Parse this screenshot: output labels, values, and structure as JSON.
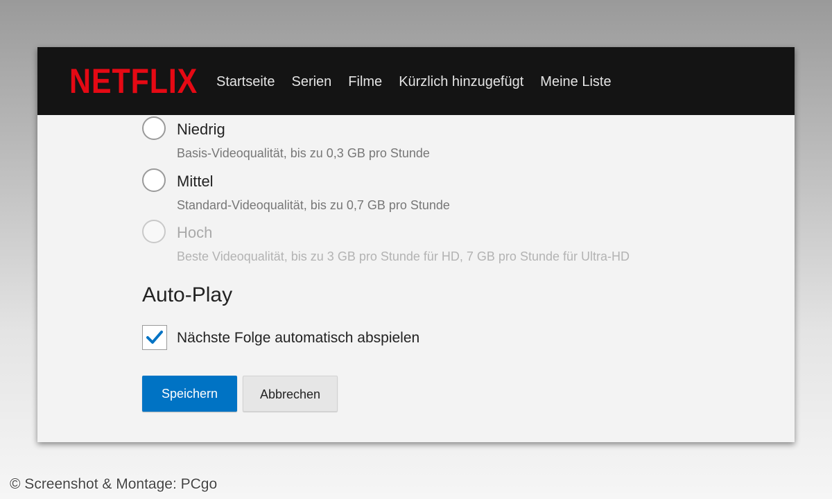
{
  "brand": {
    "logo_text": "NETFLIX",
    "logo_color": "#e50914"
  },
  "nav": {
    "items": [
      "Startseite",
      "Serien",
      "Filme",
      "Kürzlich hinzugefügt",
      "Meine Liste"
    ]
  },
  "quality_options": [
    {
      "title": "Niedrig",
      "description": "Basis-Videoqualität, bis zu 0,3 GB pro Stunde",
      "selected": false,
      "disabled": false
    },
    {
      "title": "Mittel",
      "description": "Standard-Videoqualität, bis zu 0,7 GB pro Stunde",
      "selected": false,
      "disabled": false
    },
    {
      "title": "Hoch",
      "description": "Beste Videoqualität, bis zu 3 GB pro Stunde für HD, 7 GB pro Stunde für Ultra-HD",
      "selected": false,
      "disabled": true
    }
  ],
  "autoplay": {
    "heading": "Auto-Play",
    "checkbox_label": "Nächste Folge automatisch abspielen",
    "checked": true,
    "check_icon": "checkmark-icon"
  },
  "actions": {
    "save_label": "Speichern",
    "cancel_label": "Abbrechen",
    "save_color": "#0073c4"
  },
  "credit": "© Screenshot & Montage: PCgo"
}
